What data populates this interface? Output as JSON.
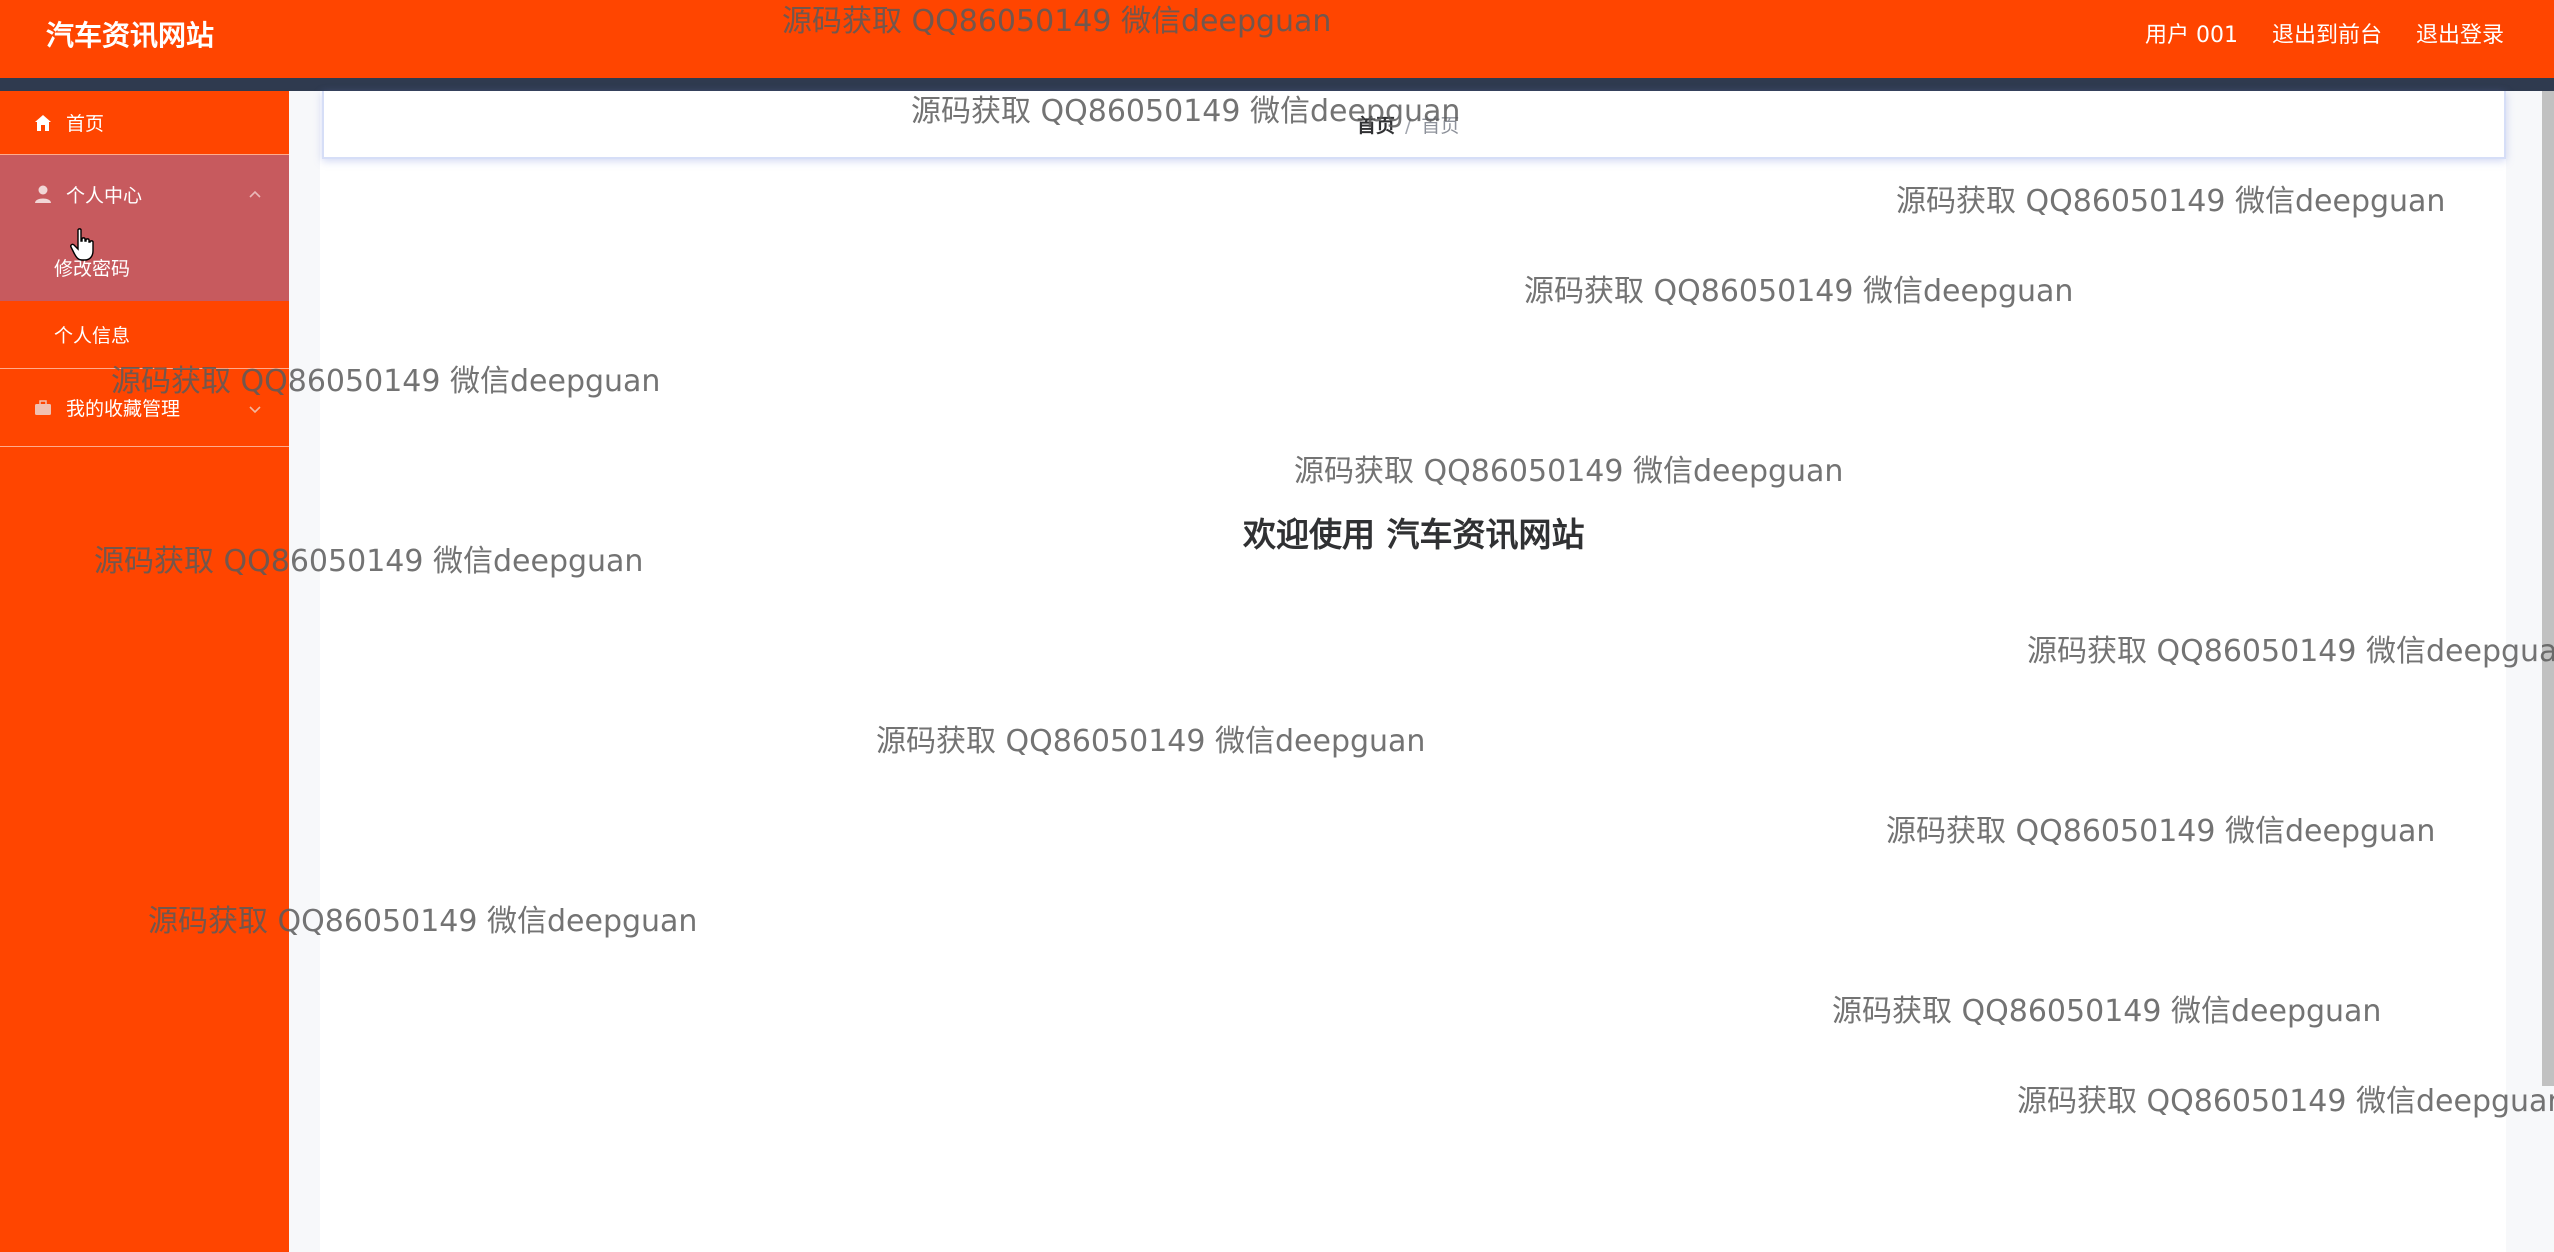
{
  "header": {
    "brand": "汽车资讯网站",
    "links": [
      "用户 001",
      "退出到前台",
      "退出登录"
    ]
  },
  "sidebar": {
    "items": [
      {
        "label": "首页",
        "icon": "home-icon"
      },
      {
        "label": "个人中心",
        "icon": "user-icon",
        "expanded": true,
        "children": [
          "修改密码",
          "个人信息"
        ]
      },
      {
        "label": "我的收藏管理",
        "icon": "briefcase-icon",
        "expanded": false
      }
    ]
  },
  "breadcrumb": {
    "home": "首页",
    "separator": "/",
    "current": "首页"
  },
  "main": {
    "welcome": "欢迎使用 汽车资讯网站"
  },
  "watermark": "源码获取 QQ86050149 微信deepguan",
  "colors": {
    "accent": "#ff4500",
    "menu_active": "#c75a5e",
    "header_strip": "#2f3a4f"
  }
}
